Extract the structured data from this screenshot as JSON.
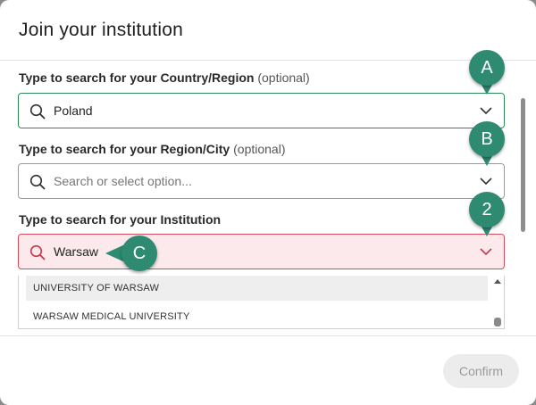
{
  "modal": {
    "title": "Join your institution"
  },
  "fields": {
    "country": {
      "label": "Type to search for your Country/Region",
      "optional": "(optional)",
      "value": "Poland"
    },
    "region": {
      "label": "Type to search for your Region/City",
      "optional": "(optional)",
      "placeholder": "Search or select option..."
    },
    "institution": {
      "label": "Type to search for your Institution",
      "value": "Warsaw",
      "options": [
        "UNIVERSITY OF WARSAW",
        "WARSAW MEDICAL UNIVERSITY"
      ]
    }
  },
  "footer": {
    "confirm_label": "Confirm"
  },
  "callouts": {
    "a": "A",
    "b": "B",
    "two": "2",
    "c": "C"
  },
  "colors": {
    "accent": "#2f8a72",
    "error_border": "#d64a5c",
    "error_bg": "#fbe9ec",
    "active_border": "#2e8b57"
  },
  "icons": {
    "search": "search-icon",
    "chevron": "chevron-down-icon"
  }
}
